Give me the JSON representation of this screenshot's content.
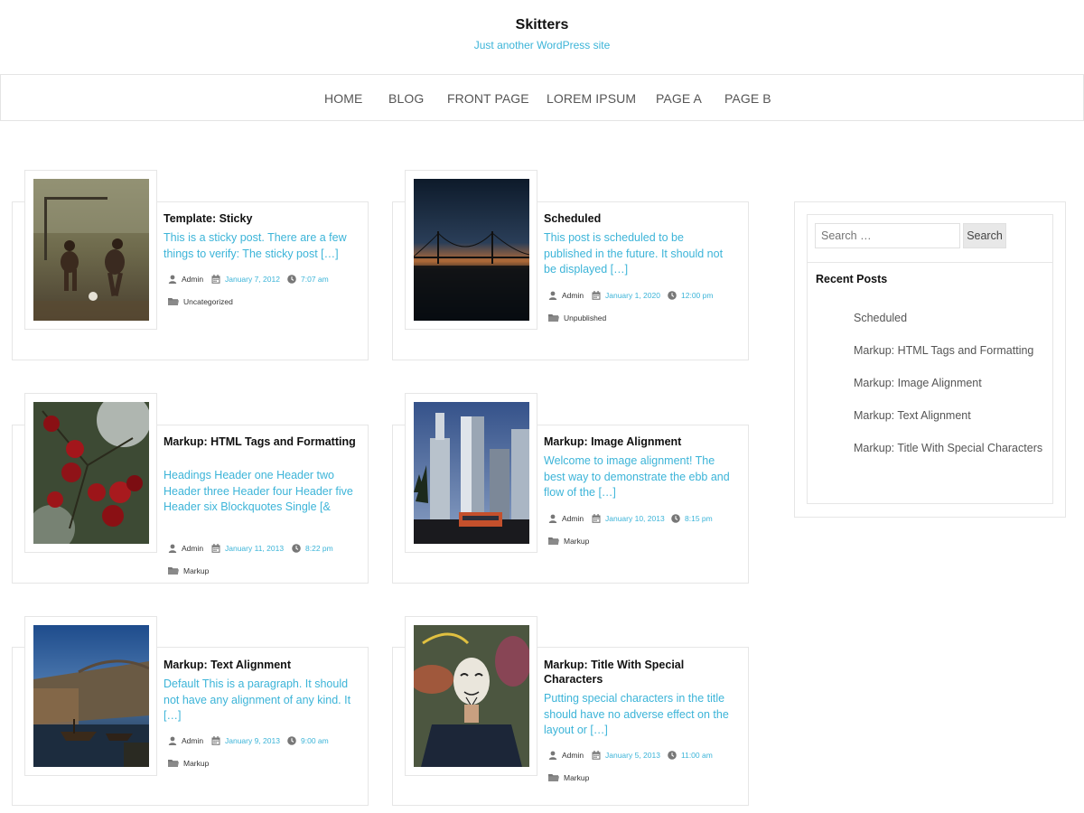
{
  "site": {
    "title": "Skitters",
    "description": "Just another WordPress site"
  },
  "nav": [
    "HOME",
    "BLOG",
    "FRONT PAGE",
    "LOREM IPSUM",
    "PAGE A",
    "PAGE B"
  ],
  "colors": {
    "accent": "#3cb4d8",
    "border": "#e6e6e6",
    "text": "#222222"
  },
  "posts": [
    {
      "title": "Template: Sticky",
      "excerpt": "This is a sticky post. There are a few things to verify: The sticky post […]",
      "author": "Admin",
      "date": "January 7, 2012",
      "time": "7:07 am",
      "category": "Uncategorized",
      "image": "kids-playing-soccer"
    },
    {
      "title": "Scheduled",
      "excerpt": "This post is scheduled to be published in the future. It should not be displayed […]",
      "author": "Admin",
      "date": "January 1, 2020",
      "time": "12:00 pm",
      "category": "Unpublished",
      "image": "bridge-at-dusk"
    },
    {
      "title": "Markup: HTML Tags and Formatting",
      "excerpt": "Headings Header one Header two Header three Header four Header five Header six Blockquotes Single [&",
      "author": "Admin",
      "date": "January 11, 2013",
      "time": "8:22 pm",
      "category": "Markup",
      "image": "red-cherries"
    },
    {
      "title": "Markup: Image Alignment",
      "excerpt": "Welcome to image alignment! The best way to demonstrate the ebb and flow of the […]",
      "author": "Admin",
      "date": "January 10, 2013",
      "time": "8:15 pm",
      "category": "Markup",
      "image": "city-skyscrapers"
    },
    {
      "title": "Markup: Text Alignment",
      "excerpt": "Default This is a paragraph. It should not have any alignment of any kind. It […]",
      "author": "Admin",
      "date": "January 9, 2013",
      "time": "9:00 am",
      "category": "Markup",
      "image": "river-boats"
    },
    {
      "title": "Markup: Title With Special Characters",
      "excerpt": "Putting special characters in the title should have no adverse effect on the layout or […]",
      "author": "Admin",
      "date": "January 5, 2013",
      "time": "11:00 am",
      "category": "Markup",
      "image": "masked-person"
    }
  ],
  "search": {
    "placeholder": "Search …",
    "button": "Search"
  },
  "recent_posts": {
    "title": "Recent Posts",
    "items": [
      "Scheduled",
      "Markup: HTML Tags and Formatting",
      "Markup: Image Alignment",
      "Markup: Text Alignment",
      "Markup: Title With Special Characters"
    ]
  }
}
